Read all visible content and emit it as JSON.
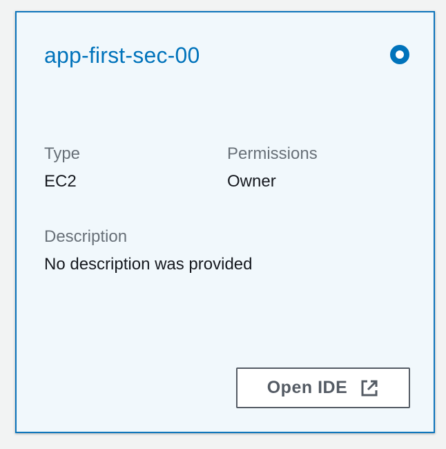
{
  "card": {
    "title": "app-first-sec-00",
    "selected": true,
    "fields": {
      "type_label": "Type",
      "type_value": "EC2",
      "permissions_label": "Permissions",
      "permissions_value": "Owner",
      "description_label": "Description",
      "description_value": "No description was provided"
    },
    "open_button": {
      "label": "Open IDE",
      "icon": "external-link-icon"
    }
  },
  "colors": {
    "accent": "#0073bb",
    "card_background": "#f1f8fc",
    "label_text": "#687078",
    "value_text": "#16191f",
    "button_text": "#545b64"
  }
}
